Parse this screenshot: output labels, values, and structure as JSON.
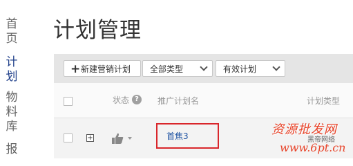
{
  "nav": {
    "items": [
      {
        "label": "首页",
        "active": false
      },
      {
        "label": "计划",
        "active": true
      },
      {
        "label": "物料库",
        "active": false
      },
      {
        "label": "报",
        "active": false
      }
    ]
  },
  "page": {
    "title": "计划管理"
  },
  "toolbar": {
    "add_label": "新建营销计划",
    "type_filter": "全部类型",
    "status_filter": "有效计划"
  },
  "table": {
    "columns": {
      "status": "状态",
      "name": "推广计划名",
      "type": "计划类型"
    },
    "rows": [
      {
        "name": "首焦3"
      }
    ]
  },
  "watermark": {
    "text": "资源批发网",
    "sub": "黑帝网络",
    "site": "www.6pt.cn"
  },
  "colors": {
    "highlight_border": "#d9262b",
    "link": "#1a4fa0",
    "nav_active": "#1f3f8a"
  }
}
